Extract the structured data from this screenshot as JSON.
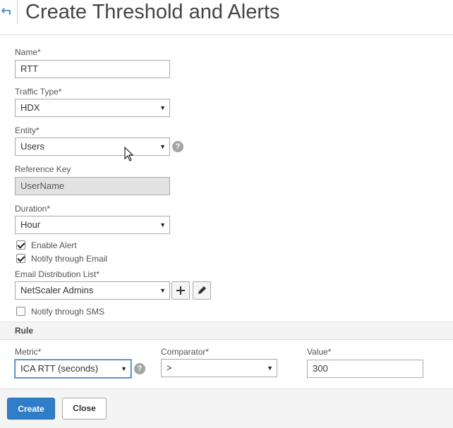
{
  "page": {
    "title": "Create Threshold and Alerts"
  },
  "form": {
    "name": {
      "label": "Name*",
      "value": "RTT"
    },
    "traffic_type": {
      "label": "Traffic Type*",
      "value": "HDX"
    },
    "entity": {
      "label": "Entity*",
      "value": "Users"
    },
    "reference_key": {
      "label": "Reference Key",
      "value": "UserName"
    },
    "duration": {
      "label": "Duration*",
      "value": "Hour"
    },
    "enable_alert": {
      "label": "Enable Alert",
      "checked": true
    },
    "notify_email": {
      "label": "Notify through Email",
      "checked": true
    },
    "email_list": {
      "label": "Email Distribution List*",
      "value": "NetScaler Admins"
    },
    "notify_sms": {
      "label": "Notify through SMS",
      "checked": false
    }
  },
  "rule": {
    "title": "Rule",
    "metric": {
      "label": "Metric*",
      "value": "ICA RTT (seconds)"
    },
    "comparator": {
      "label": "Comparator*",
      "value": ">"
    },
    "value": {
      "label": "Value*",
      "value": "300"
    }
  },
  "footer": {
    "create_label": "Create",
    "close_label": "Close"
  },
  "icons": {
    "back": "back-arrow-icon",
    "help": "question-icon",
    "add": "plus-icon",
    "edit": "pencil-icon",
    "dropdown": "caret-down-icon"
  },
  "colors": {
    "primary_button": "#2f7ec7",
    "help_icon": "#a5a5a5",
    "readonly_field": "#e2e2e2",
    "focus_border": "#3a7cc6"
  }
}
